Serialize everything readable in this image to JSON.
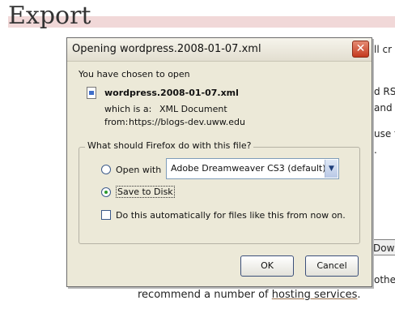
{
  "page": {
    "title": "Export",
    "fragments": [
      "ll cr",
      "d RSS",
      "and",
      "use t",
      ".",
      "othe"
    ],
    "download_button": "Dow",
    "bottom_prefix": "recommend a number of ",
    "bottom_link": "hosting services",
    "bottom_suffix": "."
  },
  "dialog": {
    "title": "Opening wordpress.2008-01-07.xml",
    "close_glyph": "✕",
    "intro": "You have chosen to open",
    "filename": "wordpress.2008-01-07.xml",
    "which_is_label": "which is a:",
    "which_is_value": "XML Document",
    "from_label": "from:",
    "from_value": "https://blogs-dev.uww.edu",
    "group_label": "What should Firefox do with this file?",
    "open_with_label": "Open with",
    "open_with_value": "Adobe Dreamweaver CS3 (default)",
    "save_label": "Save to Disk",
    "auto_label": "Do this automatically for files like this from now on.",
    "ok_label": "OK",
    "cancel_label": "Cancel",
    "selected_option": "save_to_disk",
    "auto_checked": false
  },
  "icons": {
    "close": "close-icon",
    "file": "xml-file-icon",
    "dropdown": "chevron-down-icon"
  },
  "colors": {
    "title_highlight": "#f1d8d8",
    "close_button": "#c43a1f",
    "dialog_bg": "#ece9d8"
  }
}
